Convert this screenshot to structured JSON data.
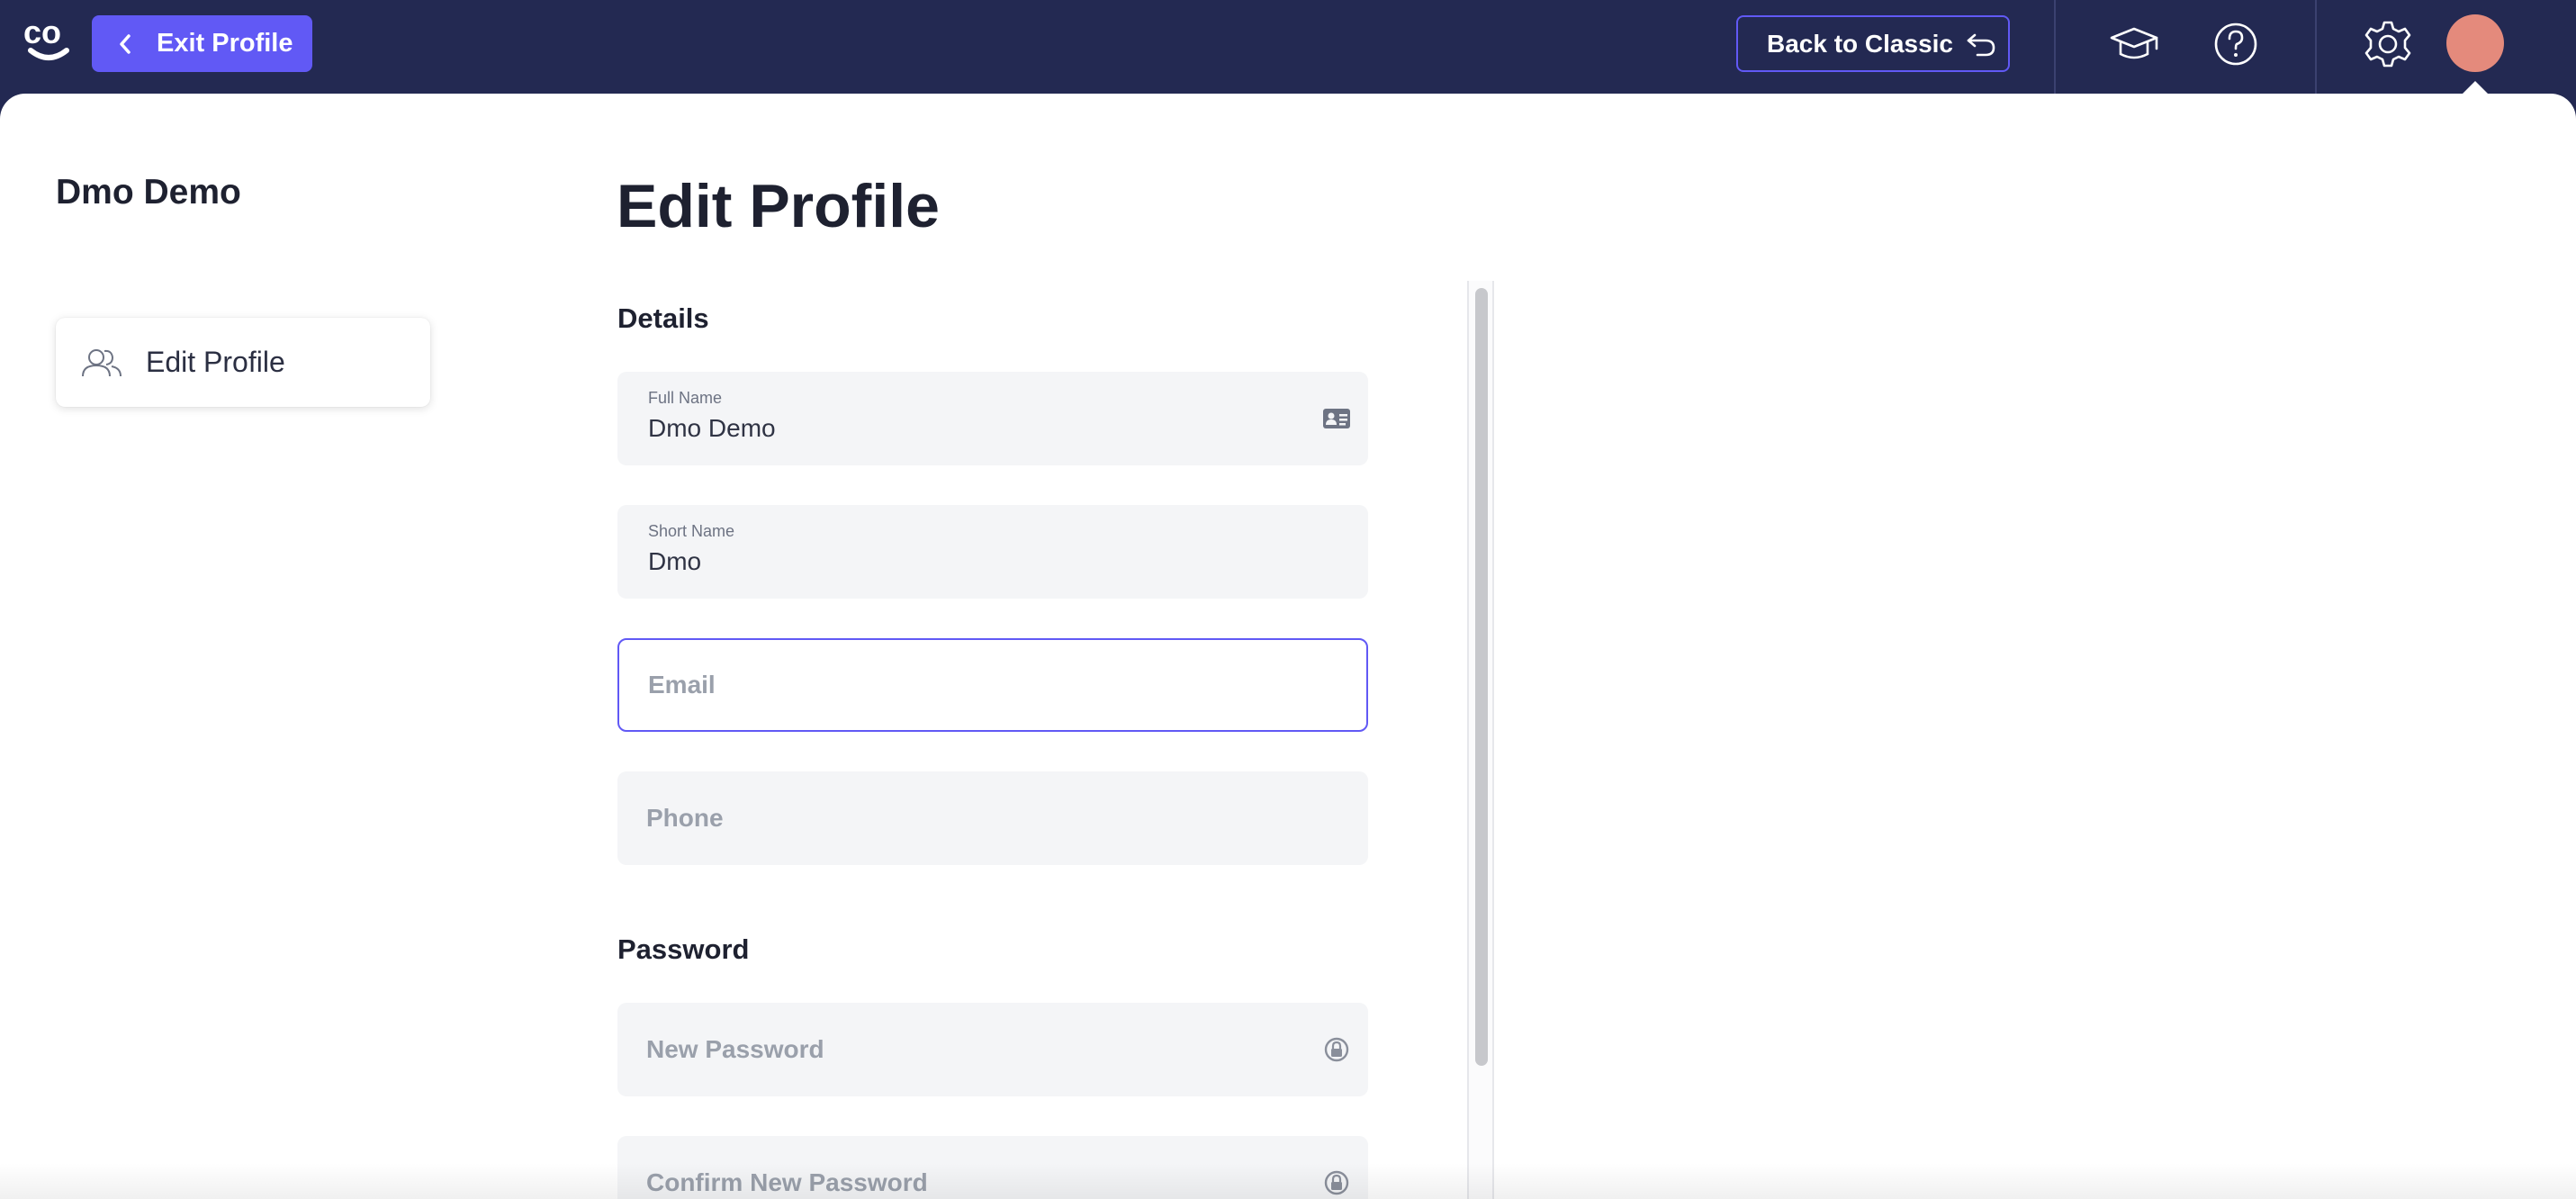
{
  "topbar": {
    "logo_text": "co",
    "exit_label": "Exit Profile",
    "classic_label": "Back to Classic",
    "icons": [
      "graduation-cap-icon",
      "help-icon",
      "gear-icon"
    ],
    "avatar_color": "#e48a7c",
    "accent": "#6159f5",
    "background": "#232952"
  },
  "sidebar": {
    "user_name": "Dmo Demo",
    "items": [
      {
        "label": "Edit Profile",
        "icon": "people-icon"
      }
    ]
  },
  "main": {
    "title": "Edit Profile",
    "details": {
      "heading": "Details",
      "full_name": {
        "label": "Full Name",
        "value": "Dmo Demo",
        "icon": "id-card-icon"
      },
      "short_name": {
        "label": "Short Name",
        "value": "Dmo"
      },
      "email": {
        "placeholder": "Email",
        "value": ""
      },
      "phone": {
        "placeholder": "Phone",
        "value": ""
      }
    },
    "password": {
      "heading": "Password",
      "new_password": {
        "placeholder": "New Password",
        "icon": "lock-icon"
      },
      "confirm_password": {
        "placeholder": "Confirm New Password",
        "icon": "lock-icon"
      }
    }
  }
}
